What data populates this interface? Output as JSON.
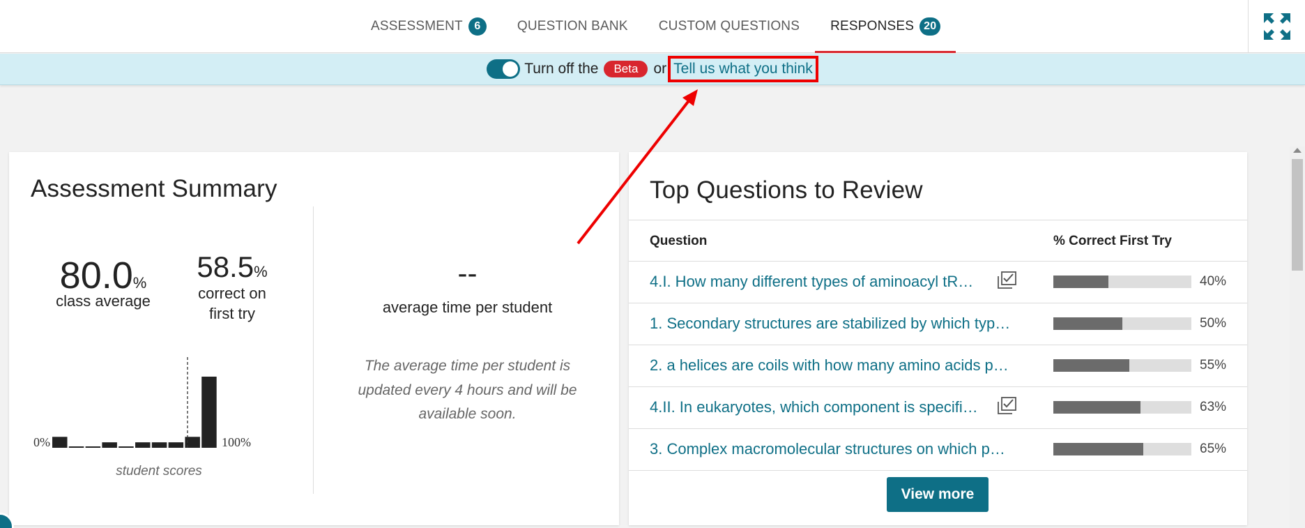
{
  "nav": {
    "tabs": [
      {
        "label": "ASSESSMENT",
        "count": "6",
        "active": false
      },
      {
        "label": "QUESTION BANK",
        "count": null,
        "active": false
      },
      {
        "label": "CUSTOM QUESTIONS",
        "count": null,
        "active": false
      },
      {
        "label": "RESPONSES",
        "count": "20",
        "active": true
      }
    ],
    "expand_icon": "expand-arrows-icon"
  },
  "banner": {
    "prefix": "Turn off the",
    "beta": "Beta",
    "middle": "or",
    "link": "Tell us what you think",
    "toggle_on": true
  },
  "summary": {
    "title": "Assessment Summary",
    "class_average": {
      "value": "80.0",
      "unit": "%",
      "label": "class average"
    },
    "first_try": {
      "value": "58.5",
      "unit": "%",
      "label_line1": "correct on",
      "label_line2": "first try"
    },
    "avg_time": {
      "value": "--",
      "label": "average time per student"
    },
    "avg_note": "The average time per student is updated every 4 hours and will be available soon."
  },
  "chart_data": {
    "type": "bar",
    "title": "",
    "xlabel": "student scores",
    "ylabel": "",
    "x_min_label": "0%",
    "x_max_label": "100%",
    "categories": [
      "0-10",
      "10-20",
      "20-30",
      "30-40",
      "40-50",
      "50-60",
      "60-70",
      "70-80",
      "80-90",
      "90-100"
    ],
    "values": [
      2,
      0,
      0,
      1,
      0,
      1,
      1,
      1,
      2,
      13
    ],
    "reference_line": 80.0,
    "grid": false
  },
  "review": {
    "title": "Top Questions to Review",
    "col_question": "Question",
    "col_pct": "% Correct First Try",
    "rows": [
      {
        "text": "4.I. How many different types of aminoacyl tR…",
        "pct": 40,
        "pct_label": "40%",
        "icon": "multi-part-question-icon"
      },
      {
        "text": "1. Secondary structures are stabilized by which typ…",
        "pct": 50,
        "pct_label": "50%",
        "icon": null
      },
      {
        "text": "2. a helices are coils with how many amino acids p…",
        "pct": 55,
        "pct_label": "55%",
        "icon": null
      },
      {
        "text": "4.II. In eukaryotes, which component is specifi…",
        "pct": 63,
        "pct_label": "63%",
        "icon": "multi-part-question-icon"
      },
      {
        "text": "3. Complex macromolecular structures on which p…",
        "pct": 65,
        "pct_label": "65%",
        "icon": null
      }
    ],
    "view_more": "View more"
  },
  "colors": {
    "accent": "#0e6f86",
    "active_underline": "#d8262e",
    "beta_pill": "#d8262e",
    "banner_bg": "#d3eef5",
    "annotation": "#ee0000",
    "bar_fill": "#6b6b6b",
    "histogram": "#222222"
  }
}
